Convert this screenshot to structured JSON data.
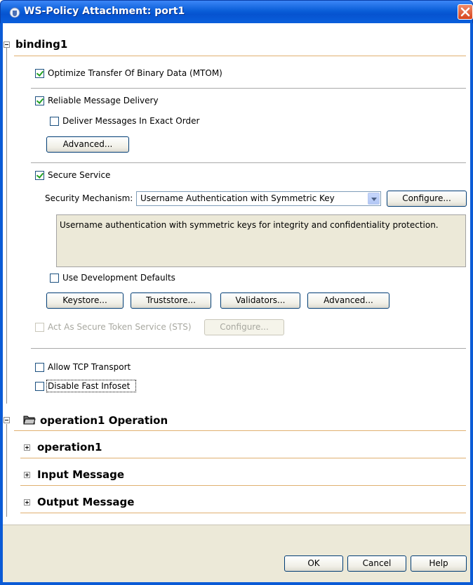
{
  "window": {
    "title": "WS-Policy Attachment: port1",
    "icons": {
      "app": "java-cup-icon",
      "close": "close-icon"
    }
  },
  "binding": {
    "title": "binding1",
    "mtom": {
      "label": "Optimize Transfer Of Binary Data (MTOM)",
      "checked": true
    },
    "reliable": {
      "label": "Reliable Message Delivery",
      "checked": true
    },
    "exact_order": {
      "label": "Deliver Messages In Exact Order",
      "checked": false
    },
    "reliable_advanced_label": "Advanced...",
    "secure": {
      "label": "Secure Service",
      "checked": true
    },
    "security_mechanism_label": "Security Mechanism:",
    "security_mechanism_value": "Username Authentication with Symmetric Key",
    "configure_label": "Configure...",
    "mechanism_description": "Username authentication with symmetric keys for integrity and confidentiality protection.",
    "dev_defaults": {
      "label": "Use Development Defaults",
      "checked": false
    },
    "keystore_label": "Keystore...",
    "truststore_label": "Truststore...",
    "validators_label": "Validators...",
    "security_advanced_label": "Advanced...",
    "sts": {
      "label": "Act As Secure Token Service (STS)",
      "checked": false,
      "enabled": false
    },
    "sts_configure_label": "Configure...",
    "tcp": {
      "label": "Allow TCP Transport",
      "checked": false
    },
    "fast_infoset": {
      "label": "Disable Fast Infoset",
      "checked": false
    }
  },
  "operation": {
    "title": "operation1 Operation",
    "icon": "folder-open-icon",
    "children": [
      "operation1",
      "Input Message",
      "Output Message"
    ]
  },
  "buttons": {
    "ok": "OK",
    "cancel": "Cancel",
    "help": "Help"
  },
  "colors": {
    "titlebar": "#0a5ed8",
    "panel": "#ece9d8",
    "separator": "#e0b070",
    "check": "#21a121"
  }
}
